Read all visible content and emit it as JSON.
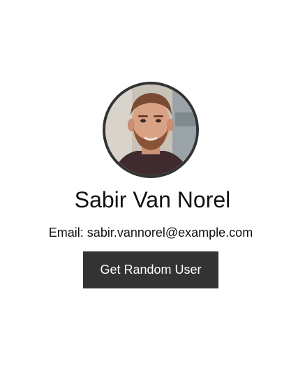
{
  "user": {
    "name": "Sabir Van Norel",
    "email_line": "Email: sabir.vannorel@example.com",
    "avatar_icon": "profile-photo"
  },
  "actions": {
    "get_random_user_label": "Get Random User"
  },
  "colors": {
    "background": "#ffffff",
    "button_bg": "#333333",
    "button_text": "#ffffff",
    "avatar_border": "#333333",
    "text": "#111111"
  }
}
